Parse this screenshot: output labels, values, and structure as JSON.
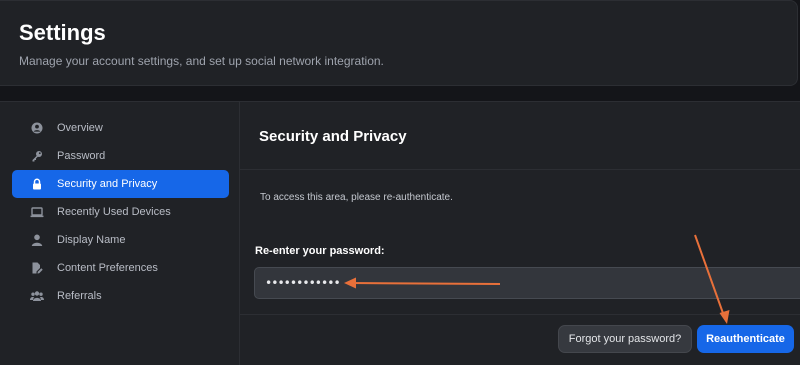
{
  "header": {
    "title": "Settings",
    "subtitle": "Manage your account settings, and set up social network integration."
  },
  "sidebar": {
    "items": [
      {
        "label": "Overview",
        "icon": "user-circle-icon",
        "active": false
      },
      {
        "label": "Password",
        "icon": "key-icon",
        "active": false
      },
      {
        "label": "Security and Privacy",
        "icon": "lock-icon",
        "active": true
      },
      {
        "label": "Recently Used Devices",
        "icon": "laptop-icon",
        "active": false
      },
      {
        "label": "Display Name",
        "icon": "user-icon",
        "active": false
      },
      {
        "label": "Content Preferences",
        "icon": "document-edit-icon",
        "active": false
      },
      {
        "label": "Referrals",
        "icon": "users-icon",
        "active": false
      }
    ]
  },
  "main": {
    "section_title": "Security and Privacy",
    "info_text": "To access this area, please re-authenticate.",
    "password_label": "Re-enter your password:",
    "password_value": "••••••••••••",
    "forgot_button": "Forgot your password?",
    "reauth_button": "Reauthenticate"
  },
  "colors": {
    "accent": "#1667e8",
    "annotation_arrow": "#e8703a",
    "background": "#141519",
    "panel": "#202226"
  }
}
